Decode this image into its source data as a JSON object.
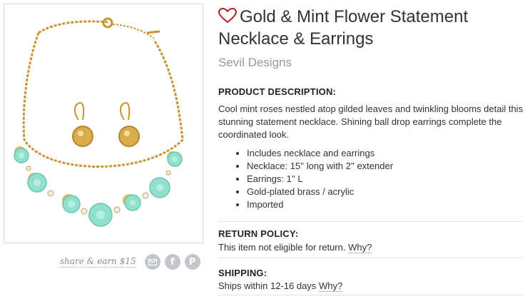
{
  "product": {
    "title": "Gold & Mint Flower Statement Necklace & Earrings",
    "brand": "Sevil Designs",
    "image_icon": "necklace-product-image"
  },
  "share": {
    "label": "share & earn $15",
    "icons": [
      "email-icon",
      "facebook-icon",
      "pinterest-icon"
    ]
  },
  "description": {
    "heading": "PRODUCT DESCRIPTION:",
    "text": "Cool mint roses nestled atop gilded leaves and twinkling blooms detail this stunning statement necklace. Shining ball drop earrings complete the coordinated look.",
    "bullets": [
      "Includes necklace and earrings",
      "Necklace: 15'' long with 2'' extender",
      "Earrings: 1'' L",
      "Gold-plated brass / acrylic",
      "Imported"
    ]
  },
  "return_policy": {
    "heading": "RETURN POLICY:",
    "text": "This item not eligible for return.",
    "why": "Why?"
  },
  "shipping": {
    "heading": "SHIPPING:",
    "text": "Ships within 12-16 days",
    "why": "Why?"
  },
  "colors": {
    "heart": "#b11e2b",
    "gold": "#d4a23c",
    "mint": "#8fe0cc",
    "icon_gray": "#c3c7cb"
  }
}
